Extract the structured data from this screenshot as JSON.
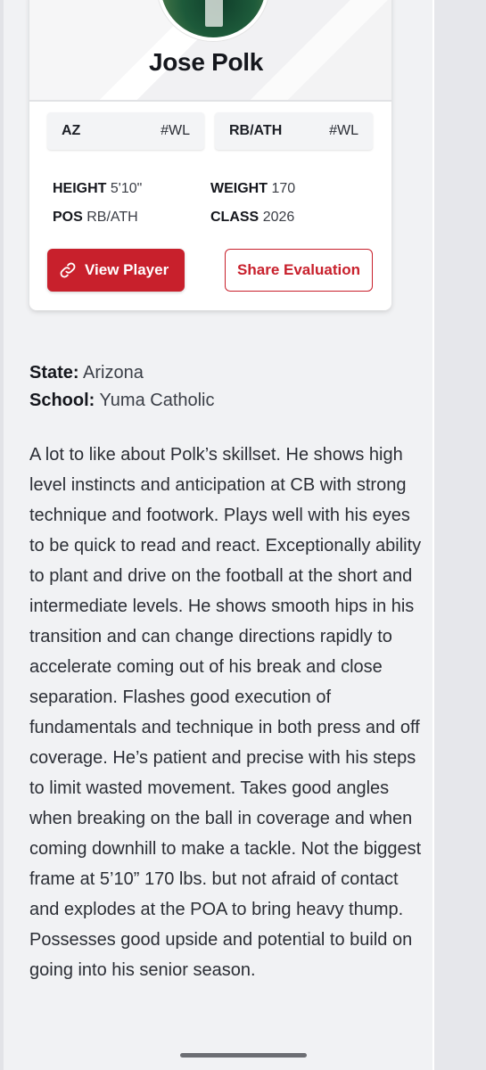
{
  "player": {
    "name": "Jose Polk",
    "state_chip": {
      "label": "AZ",
      "rank": "#WL"
    },
    "position_chip": {
      "label": "RB/ATH",
      "rank": "#WL"
    },
    "stats": {
      "height_label": "HEIGHT",
      "height_value": "5'10\"",
      "weight_label": "WEIGHT",
      "weight_value": "170",
      "pos_label": "POS",
      "pos_value": "RB/ATH",
      "class_label": "CLASS",
      "class_value": "2026"
    },
    "buttons": {
      "view_player": "View Player",
      "share_evaluation": "Share Evaluation"
    },
    "icons": {
      "view_player": "link-icon"
    }
  },
  "details": {
    "state_label": "State:",
    "state_value": "Arizona",
    "school_label": "School:",
    "school_value": "Yuma Catholic"
  },
  "evaluation": {
    "text": "A lot to like about Polk’s skillset. He shows high level instincts and anticipation at CB with strong technique and footwork. Plays well with his eyes to be quick to read and react. Exceptionally ability to plant and drive on the football at the short and intermediate levels. He shows smooth hips in his transition and can change directions rapidly to accelerate coming out of his break and close separation. Flashes good execution of fundamentals and technique in both press and off coverage. He’s patient and precise with his steps to limit wasted movement. Takes good angles when breaking on the ball in coverage and when coming downhill to make a tackle. Not the biggest frame at 5’10” 170 lbs. but not afraid of contact and explodes at the POA to bring heavy thump. Possesses good upside and potential to build on going into his senior season."
  },
  "colors": {
    "accent": "#c8202c",
    "background": "#f1f2f4",
    "card": "#ffffff",
    "chip": "#f3f4f6",
    "text": "#1f2430"
  }
}
